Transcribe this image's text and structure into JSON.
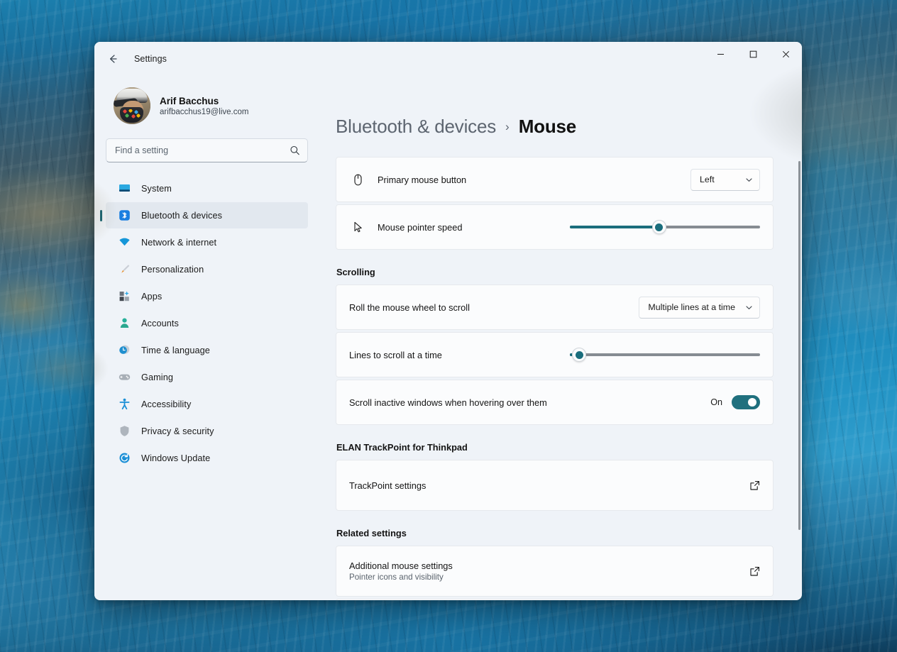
{
  "window": {
    "titlebar_title": "Settings",
    "back_icon": "back-arrow-icon",
    "minimize_label": "—",
    "maximize_label": "☐",
    "close_label": "✕"
  },
  "account": {
    "name": "Arif Bacchus",
    "email": "arifbacchus19@live.com",
    "avatar_alt": "user-avatar-photo"
  },
  "search": {
    "placeholder": "Find a setting",
    "value": "",
    "icon": "search-icon"
  },
  "sidebar": {
    "items": [
      {
        "label": "System",
        "icon": "monitor-icon",
        "selected": false
      },
      {
        "label": "Bluetooth & devices",
        "icon": "bluetooth-icon",
        "selected": true
      },
      {
        "label": "Network & internet",
        "icon": "wifi-icon",
        "selected": false
      },
      {
        "label": "Personalization",
        "icon": "paintbrush-icon",
        "selected": false
      },
      {
        "label": "Apps",
        "icon": "apps-grid-icon",
        "selected": false
      },
      {
        "label": "Accounts",
        "icon": "person-icon",
        "selected": false
      },
      {
        "label": "Time & language",
        "icon": "clock-globe-icon",
        "selected": false
      },
      {
        "label": "Gaming",
        "icon": "gamepad-icon",
        "selected": false
      },
      {
        "label": "Accessibility",
        "icon": "accessibility-icon",
        "selected": false
      },
      {
        "label": "Privacy & security",
        "icon": "shield-icon",
        "selected": false
      },
      {
        "label": "Windows Update",
        "icon": "update-refresh-icon",
        "selected": false
      }
    ]
  },
  "breadcrumb": {
    "parent": "Bluetooth & devices",
    "separator": "›",
    "current": "Mouse"
  },
  "main": {
    "primary_button": {
      "label": "Primary mouse button",
      "icon": "mouse-icon",
      "value": "Left",
      "chevron": "chevron-down-icon"
    },
    "pointer_speed": {
      "label": "Mouse pointer speed",
      "icon": "cursor-arrow-icon",
      "value_percent": 47
    },
    "scrolling_heading": "Scrolling",
    "wheel_scroll": {
      "label": "Roll the mouse wheel to scroll",
      "value": "Multiple lines at a time",
      "chevron": "chevron-down-icon"
    },
    "lines_to_scroll": {
      "label": "Lines to scroll at a time",
      "value_percent": 5
    },
    "inactive_scroll": {
      "label": "Scroll inactive windows when hovering over them",
      "state": "On"
    },
    "elan_heading": "ELAN TrackPoint for Thinkpad",
    "trackpoint": {
      "label": "TrackPoint settings",
      "icon": "external-link-icon"
    },
    "related_heading": "Related settings",
    "additional_mouse": {
      "label": "Additional mouse settings",
      "sublabel": "Pointer icons and visibility",
      "icon": "external-link-icon"
    }
  },
  "colors": {
    "accent_teal": "#1a6d7c",
    "toggle_on": "#20707e",
    "selected_nav_bg": "#e2e8ef",
    "window_bg": "#eff3f8",
    "card_bg": "#fbfcfd"
  }
}
